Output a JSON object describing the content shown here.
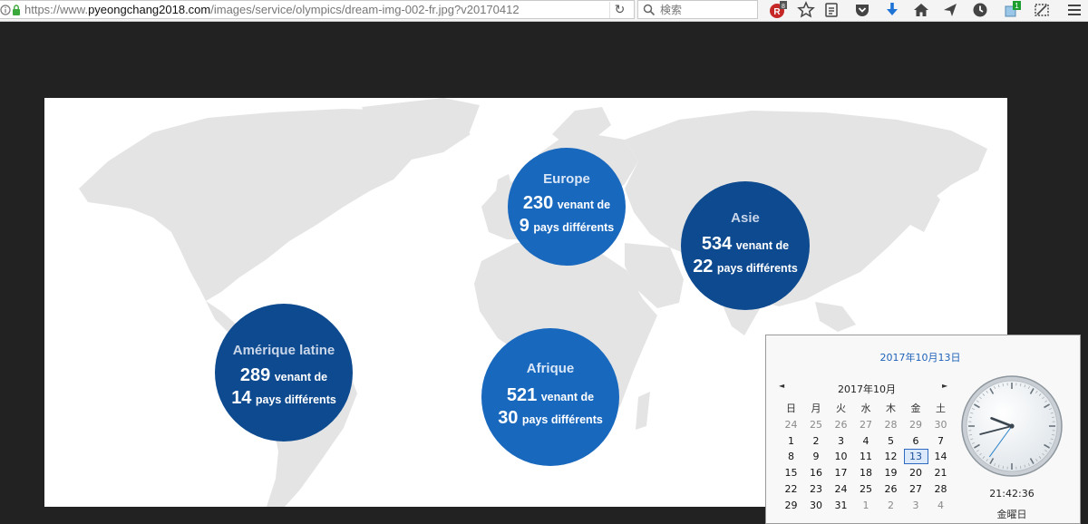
{
  "browser": {
    "url_scheme": "https://www.",
    "url_host": "pyeongchang2018.com",
    "url_path": "/images/service/olympics/dream-img-002-fr.jpg?v20170412",
    "search_placeholder": "検索",
    "badges": {
      "readability": "R",
      "readability_count": "8",
      "extension_count": "1"
    },
    "toolbar_icons": [
      "readability-icon",
      "star-icon",
      "reading-list-icon",
      "pocket-icon",
      "download-icon",
      "home-icon",
      "send-icon",
      "history-icon",
      "extension-icon",
      "screenshot-icon",
      "menu-icon"
    ]
  },
  "colors": {
    "circle_light": "#1868be",
    "circle_dark": "#0d4a8f",
    "map_gray": "#e4e4e4",
    "background": "#222222"
  },
  "regions": [
    {
      "id": "europe",
      "name": "Europe",
      "count": "230",
      "count_suffix": "venant de",
      "countries": "9",
      "countries_suffix": "pays différents"
    },
    {
      "id": "asie",
      "name": "Asie",
      "count": "534",
      "count_suffix": "venant de",
      "countries": "22",
      "countries_suffix": "pays différents"
    },
    {
      "id": "amerique",
      "name": "Amérique latine",
      "count": "289",
      "count_suffix": "venant de",
      "countries": "14",
      "countries_suffix": "pays différents"
    },
    {
      "id": "afrique",
      "name": "Afrique",
      "count": "521",
      "count_suffix": "venant de",
      "countries": "30",
      "countries_suffix": "pays différents"
    }
  ],
  "clock_popup": {
    "full_date": "2017年10月13日",
    "month_label": "2017年10月",
    "weekdays": [
      "日",
      "月",
      "火",
      "水",
      "木",
      "金",
      "土"
    ],
    "weeks": [
      [
        "24",
        "25",
        "26",
        "27",
        "28",
        "29",
        "30"
      ],
      [
        "1",
        "2",
        "3",
        "4",
        "5",
        "6",
        "7"
      ],
      [
        "8",
        "9",
        "10",
        "11",
        "12",
        "13",
        "14"
      ],
      [
        "15",
        "16",
        "17",
        "18",
        "19",
        "20",
        "21"
      ],
      [
        "22",
        "23",
        "24",
        "25",
        "26",
        "27",
        "28"
      ],
      [
        "29",
        "30",
        "31",
        "1",
        "2",
        "3",
        "4"
      ]
    ],
    "today": "13",
    "time": "21:42:36",
    "weekday_label": "金曜日"
  }
}
